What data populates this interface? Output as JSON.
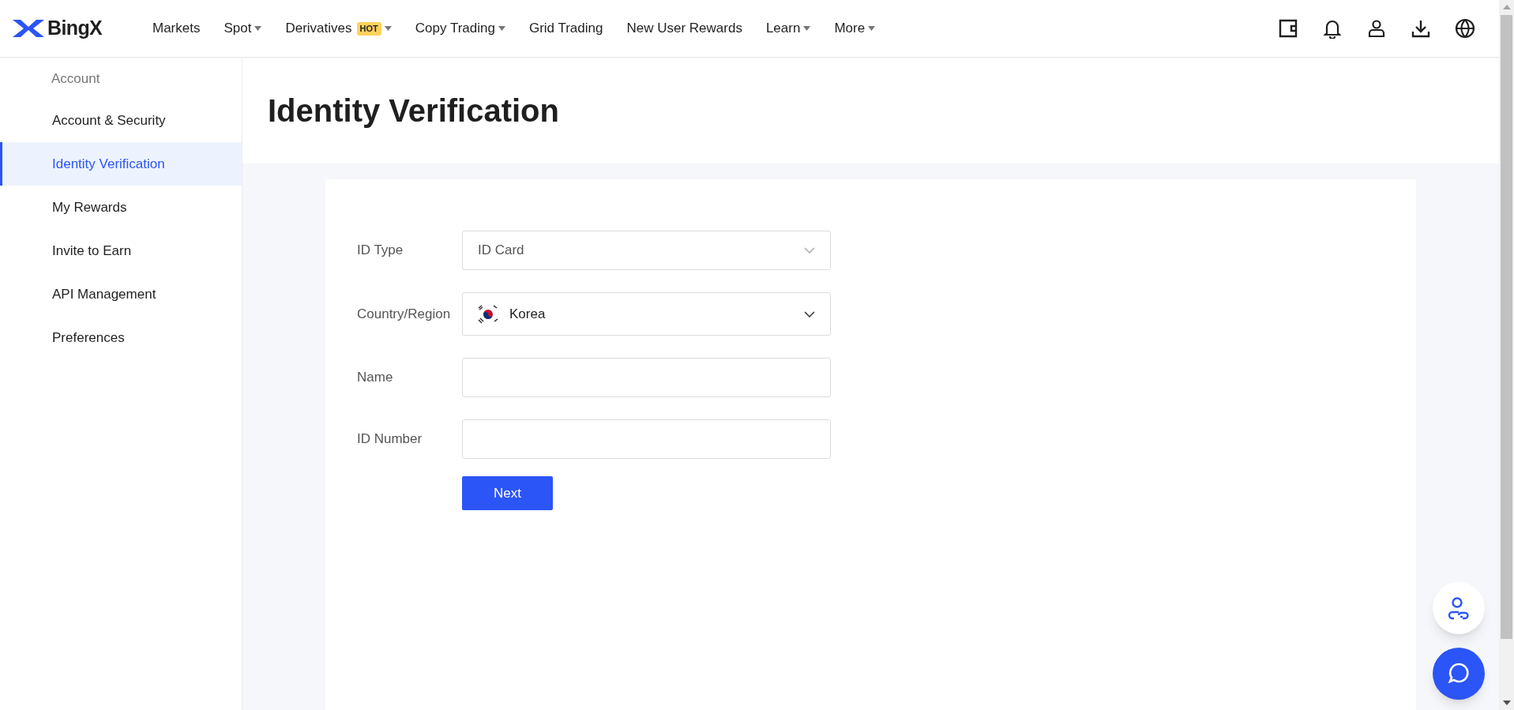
{
  "header": {
    "logo": "BingX",
    "nav": [
      {
        "label": "Markets",
        "dropdown": false
      },
      {
        "label": "Spot",
        "dropdown": true
      },
      {
        "label": "Derivatives",
        "dropdown": true,
        "badge": "HOT"
      },
      {
        "label": "Copy Trading",
        "dropdown": true
      },
      {
        "label": "Grid Trading",
        "dropdown": false
      },
      {
        "label": "New User Rewards",
        "dropdown": false
      },
      {
        "label": "Learn",
        "dropdown": true
      },
      {
        "label": "More",
        "dropdown": true
      }
    ]
  },
  "sidebar": {
    "heading": "Account",
    "items": [
      {
        "label": "Account & Security",
        "selected": false
      },
      {
        "label": "Identity Verification",
        "selected": true
      },
      {
        "label": "My Rewards",
        "selected": false
      },
      {
        "label": "Invite to Earn",
        "selected": false
      },
      {
        "label": "API Management",
        "selected": false
      },
      {
        "label": "Preferences",
        "selected": false
      }
    ]
  },
  "page_title": "Identity Verification",
  "form": {
    "fields": [
      {
        "kind": "select",
        "label": "ID Type",
        "value": "ID Card"
      },
      {
        "kind": "country",
        "label": "Country/Region",
        "value": "Korea"
      },
      {
        "kind": "text",
        "label": "Name"
      },
      {
        "kind": "text",
        "label": "ID Number"
      }
    ],
    "submit": "Next"
  }
}
